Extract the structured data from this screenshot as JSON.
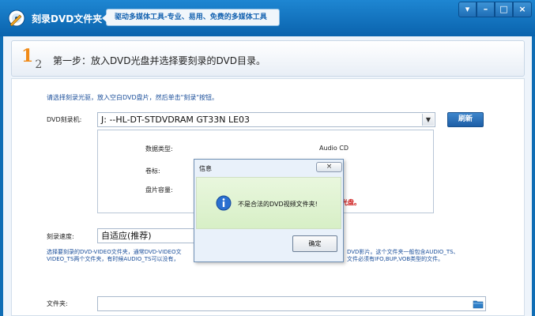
{
  "window": {
    "title": "刻录DVD文件夹",
    "slogan": "驱动多媒体工具-专业、易用、免费的多媒体工具",
    "controls": {
      "menu": "▾",
      "minimize": "–",
      "maximize": "□",
      "close": "×"
    }
  },
  "step": {
    "num_main": "1",
    "num_sub": "2",
    "text": "第一步：放入DVD光盘并选择要刻录的DVD目录。"
  },
  "form": {
    "instruction": "请选择刻录光驱，放入空白DVD盘片，然后单击\"刻录\"按钮。",
    "drive_label": "DVD刻录机:",
    "drive_value": "J:  --HL-DT-STDVDRAM GT33N    LE03",
    "refresh_label": "刷新",
    "info": {
      "type_label": "数据类型:",
      "type_value": "Audio CD",
      "volume_label": "卷标:",
      "capacity_label": "盘片容量:",
      "red_fragment": "光盘。"
    },
    "speed_label": "刻录速度:",
    "speed_value": "自适应(推荐)",
    "desc_line1_left": "选择要刻录的DVD-VIDEO文件夹，通常DVD-VIDEO文",
    "desc_line1_right": "DVD影片。这个文件夹一般包含AUDIO_TS、",
    "desc_line2_left": "VIDEO_TS两个文件夹，有时候AUDIO_TS可以没有，",
    "desc_line2_right": "文件必须有IFO,BUP,VOB类型的文件。",
    "folder_label": "文件夹:",
    "folder_value": ""
  },
  "dialog": {
    "title": "信息",
    "message": "不是合法的DVD视频文件夹!",
    "ok_label": "确定",
    "close_label": "×"
  }
}
